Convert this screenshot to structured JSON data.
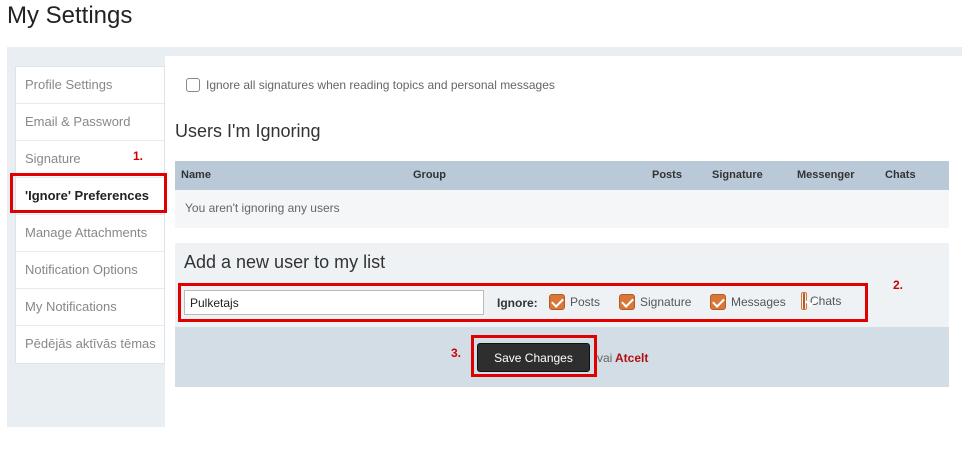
{
  "page": {
    "title": "My Settings"
  },
  "sidebar": {
    "items": [
      {
        "label": "Profile Settings"
      },
      {
        "label": "Email & Password"
      },
      {
        "label": "Signature"
      },
      {
        "label": "'Ignore' Preferences"
      },
      {
        "label": "Manage Attachments"
      },
      {
        "label": "Notification Options"
      },
      {
        "label": "My Notifications"
      },
      {
        "label": "Pēdējās aktīvās tēmas"
      }
    ]
  },
  "main": {
    "ignore_signatures_label": "Ignore all signatures when reading topics and personal messages",
    "ignoring_title": "Users I'm Ignoring",
    "table": {
      "columns": [
        "Name",
        "Group",
        "Posts",
        "Signature",
        "Messenger",
        "Chats"
      ],
      "empty_text": "You aren't ignoring any users"
    },
    "add_user": {
      "title": "Add a new user to my list",
      "input_value": "Pulketajs",
      "ignore_label": "Ignore:",
      "options": [
        "Posts",
        "Signature",
        "Messages",
        "Chats"
      ]
    },
    "footer": {
      "save_label": "Save Changes",
      "or_text": "vai",
      "cancel_label": "Atcelt"
    }
  },
  "annotations": {
    "marker1": "1.",
    "marker2": "2.",
    "marker3": "3."
  },
  "colors": {
    "highlight": "#e00000",
    "checkbox": "#d8773a",
    "table_header": "#b9c9d8"
  }
}
